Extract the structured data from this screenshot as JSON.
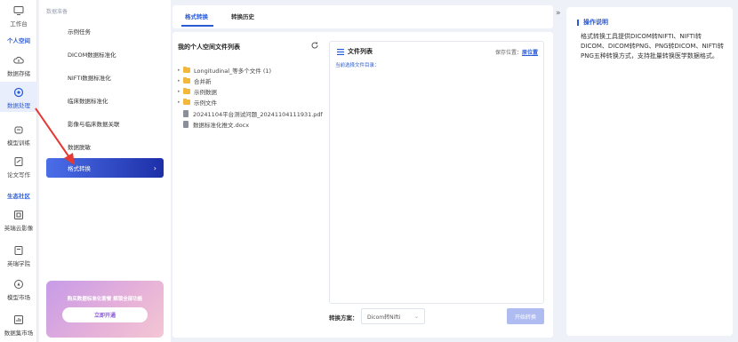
{
  "rail": {
    "items": [
      {
        "label": "工作台"
      },
      {
        "label": "数据存储"
      },
      {
        "label": "数据处理"
      },
      {
        "label": "模型训练"
      },
      {
        "label": "论文写作"
      },
      {
        "label": "英瑞云影像"
      },
      {
        "label": "英瑞学院"
      },
      {
        "label": "模型市场"
      },
      {
        "label": "数据集市场"
      }
    ],
    "sections": {
      "personal": "个人空间",
      "ecosystem": "生态社区"
    }
  },
  "menu": {
    "header": "数据准备",
    "items": [
      {
        "label": "示例任务"
      },
      {
        "label": "DICOM数据标准化"
      },
      {
        "label": "NIFTI数据标准化"
      },
      {
        "label": "临床数据标准化"
      },
      {
        "label": "影像与临床数据关联"
      },
      {
        "label": "数据脱敏"
      },
      {
        "label": "格式转换"
      }
    ],
    "promo": {
      "text": "购买数据标准化套餐 解锁全部功能",
      "button": "立即开通"
    }
  },
  "tabs": [
    {
      "label": "格式转换"
    },
    {
      "label": "转换历史"
    }
  ],
  "workspace": {
    "title": "我的个人空间文件列表",
    "tree": [
      {
        "name": "Longitudinal_等多个文件 (1)",
        "type": "folder"
      },
      {
        "name": "合并新",
        "type": "folder"
      },
      {
        "name": "示例数据",
        "type": "folder"
      },
      {
        "name": "示例文件",
        "type": "folder"
      },
      {
        "name": "20241104平台测试问题_20241104111931.pdf",
        "type": "file"
      },
      {
        "name": "数据标准化推文.docx",
        "type": "file"
      }
    ]
  },
  "filelist": {
    "title": "文件列表",
    "save_prefix": "保存位置：",
    "save_location": "原位置",
    "current_dir": "当前选择文件目录："
  },
  "scheme": {
    "label": "转换方案：",
    "value": "Dicom转Nifti",
    "start": "开始转换"
  },
  "info": {
    "title": "操作说明",
    "body": "格式转换工具提供DICOM转NIFTI、NIFTI转DICOM、DICOM转PNG、PNG转DICOM、NIFTI转PNG五种转换方式，支持批量转换医学数据格式。"
  },
  "colors": {
    "accent": "#2a5bd7",
    "annotation_arrow": "#e53935"
  }
}
